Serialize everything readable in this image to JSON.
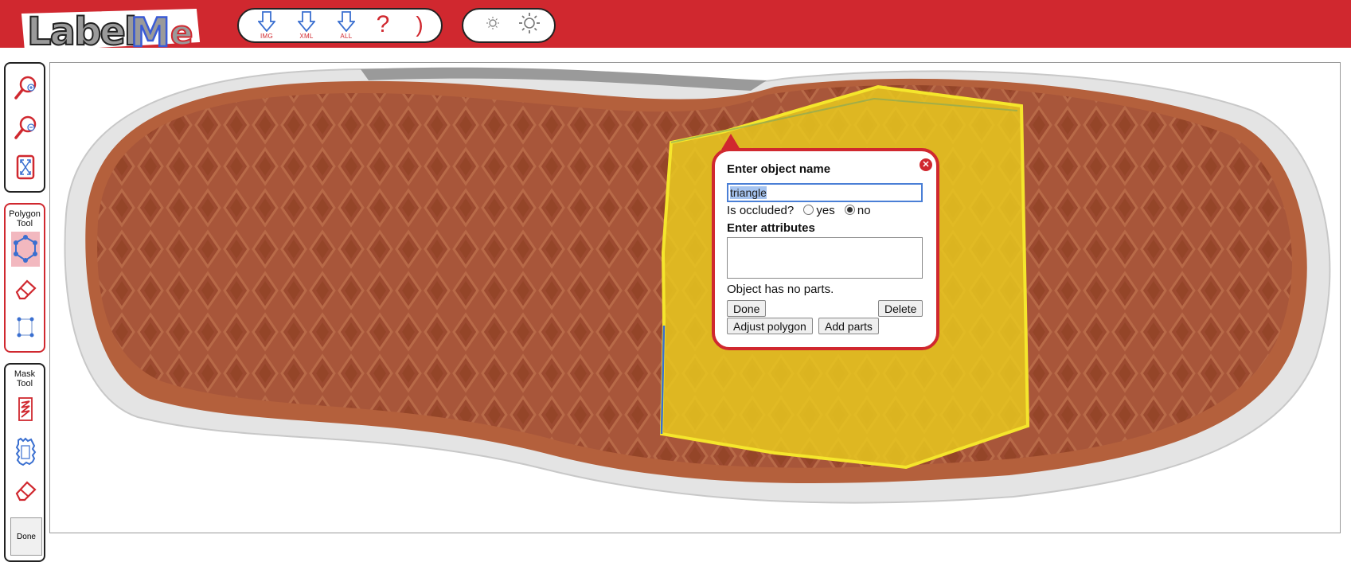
{
  "app": {
    "logo_text": "LabelMe"
  },
  "toolbar": {
    "download_image_caption": "IMG",
    "download_xml_caption": "XML",
    "download_all_caption": "ALL",
    "help_symbol": "?",
    "next_symbol": ")"
  },
  "sidebar": {
    "polygon_tool_title": "Polygon Tool",
    "mask_tool_title": "Mask Tool",
    "done_label": "Done"
  },
  "popup": {
    "title": "Enter object name",
    "name_value": "triangle",
    "occluded_label": "Is occluded?",
    "occluded_yes": "yes",
    "occluded_no": "no",
    "occluded_selected": "no",
    "attributes_label": "Enter attributes",
    "attributes_value": "",
    "parts_text": "Object has no parts.",
    "done_button": "Done",
    "delete_button": "Delete",
    "adjust_button": "Adjust polygon",
    "add_parts_button": "Add parts"
  },
  "colors": {
    "brand_red": "#d0282f",
    "polygon_stroke": "#f5e62c",
    "polygon_fill": "#e8c81e"
  }
}
